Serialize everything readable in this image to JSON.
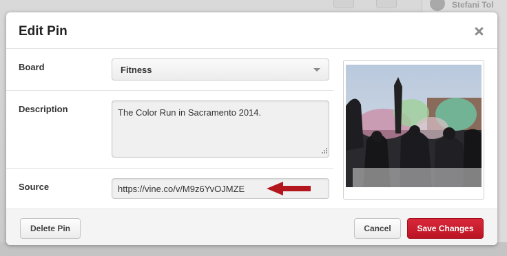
{
  "background": {
    "user_name": "Stefani Tol"
  },
  "modal": {
    "title": "Edit Pin",
    "close_icon": "close-icon"
  },
  "fields": {
    "board_label": "Board",
    "board_value": "Fitness",
    "description_label": "Description",
    "description_value": "The Color Run in Sacramento 2014.",
    "source_label": "Source",
    "source_value": "https://vine.co/v/M9z6YvOJMZE"
  },
  "annotation": {
    "arrow_icon": "arrow-left-icon",
    "arrow_color": "#b4161e"
  },
  "footer": {
    "delete_label": "Delete Pin",
    "cancel_label": "Cancel",
    "save_label": "Save Changes"
  },
  "colors": {
    "accent_red": "#c8192b",
    "modal_bg": "#ffffff",
    "footer_bg": "#f4f4f4"
  }
}
